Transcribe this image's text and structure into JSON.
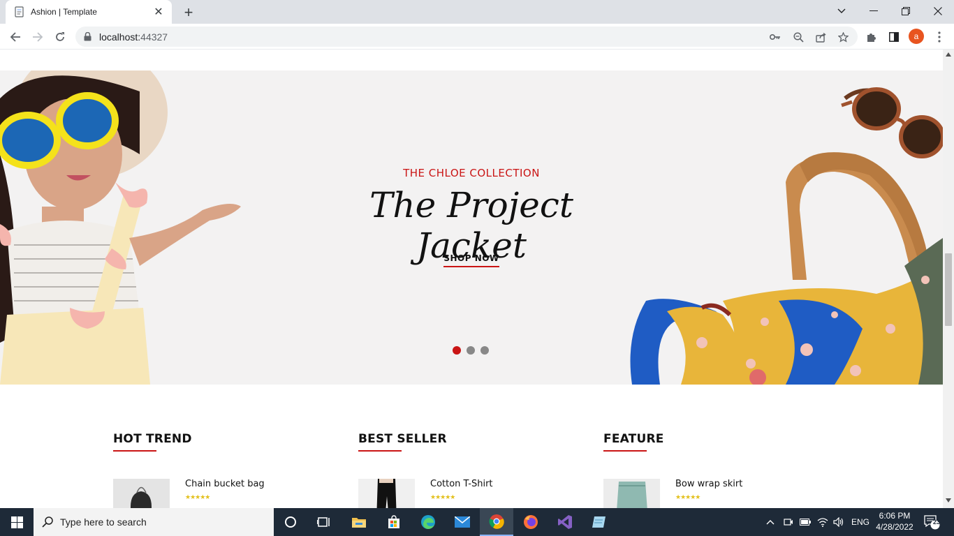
{
  "browser": {
    "tab_title": "Ashion | Template",
    "url_host": "localhost:",
    "url_port": "44327",
    "profile_initial": "a"
  },
  "hero": {
    "subtitle": "THE CHLOE COLLECTION",
    "title": "The Project Jacket",
    "cta": "SHOP NOW",
    "slides_count": 3,
    "active_slide": 1
  },
  "sections": [
    {
      "title": "HOT TREND",
      "product": {
        "name": "Chain bucket bag",
        "stars": "★★★★★",
        "rating": 5
      }
    },
    {
      "title": "BEST SELLER",
      "product": {
        "name": "Cotton T-Shirt",
        "stars": "★★★★★",
        "rating": 5
      }
    },
    {
      "title": "FEATURE",
      "product": {
        "name": "Bow wrap skirt",
        "stars": "★★★★★",
        "rating": 5
      }
    }
  ],
  "taskbar": {
    "search_placeholder": "Type here to search",
    "language": "ENG",
    "time": "6:06 PM",
    "date": "4/28/2022",
    "notification_count": "23"
  },
  "colors": {
    "accent": "#ca1515",
    "hero_bg": "#f3f2f2",
    "star": "#e3c01c"
  }
}
